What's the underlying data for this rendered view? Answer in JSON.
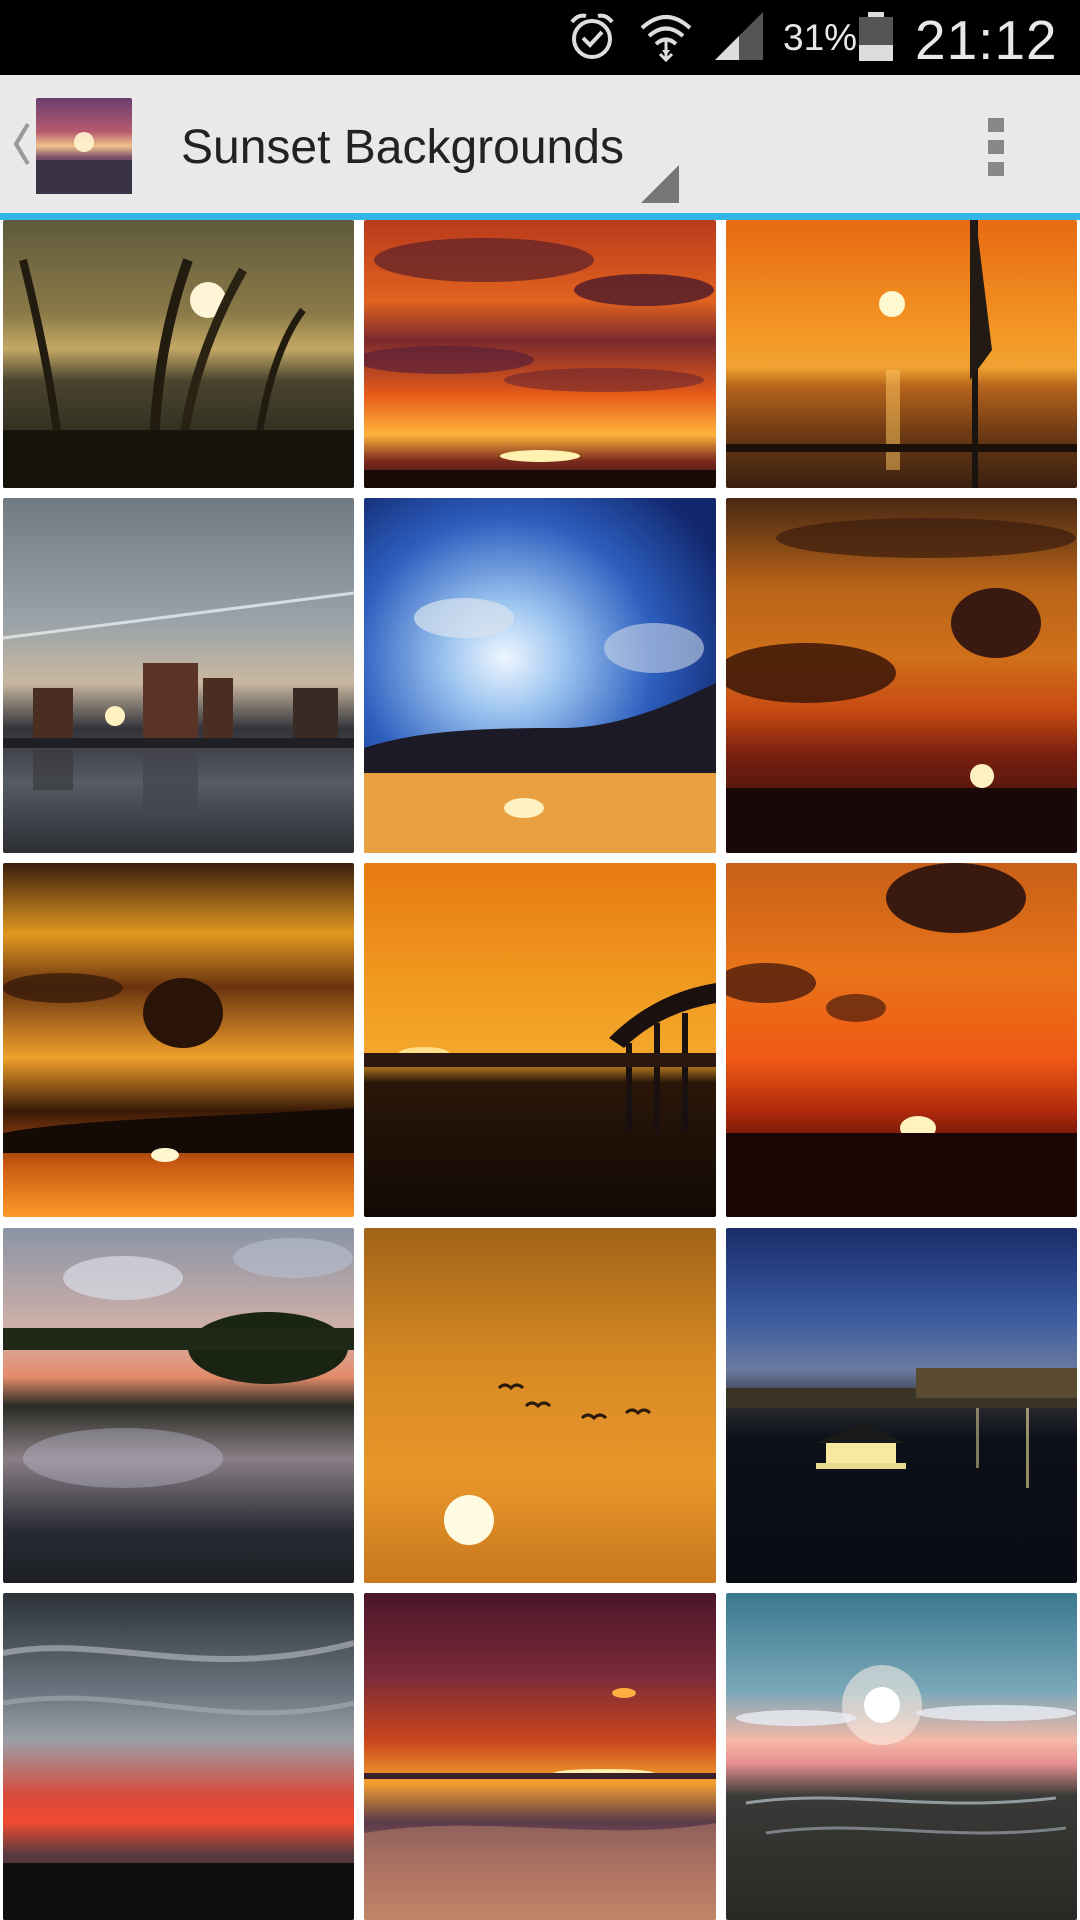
{
  "status_bar": {
    "battery_percent": "31%",
    "time": "21:12",
    "icons": [
      "alarm-icon",
      "wifi-icon",
      "signal-icon",
      "battery-icon"
    ]
  },
  "action_bar": {
    "title": "Sunset Backgrounds",
    "accent_color": "#33b5e5",
    "icons": [
      "up-caret-icon",
      "app-icon",
      "spinner-indicator-icon",
      "overflow-menu-icon"
    ]
  },
  "wallpapers": {
    "columns": 3,
    "rows_visible": 5,
    "items": [
      {
        "scene": "grass-silhouette"
      },
      {
        "scene": "red-clouds"
      },
      {
        "scene": "sea-flag"
      },
      {
        "scene": "city-reflection"
      },
      {
        "scene": "sun-rays"
      },
      {
        "scene": "dark-clouds-sun"
      },
      {
        "scene": "golden-clouds"
      },
      {
        "scene": "bridge-silhouette"
      },
      {
        "scene": "orange-sky-sun"
      },
      {
        "scene": "lake-reflection"
      },
      {
        "scene": "birds-sun"
      },
      {
        "scene": "harbor-night"
      },
      {
        "scene": "grey-red-sky"
      },
      {
        "scene": "beach-sunset"
      },
      {
        "scene": "sun-flare-plain"
      }
    ]
  }
}
